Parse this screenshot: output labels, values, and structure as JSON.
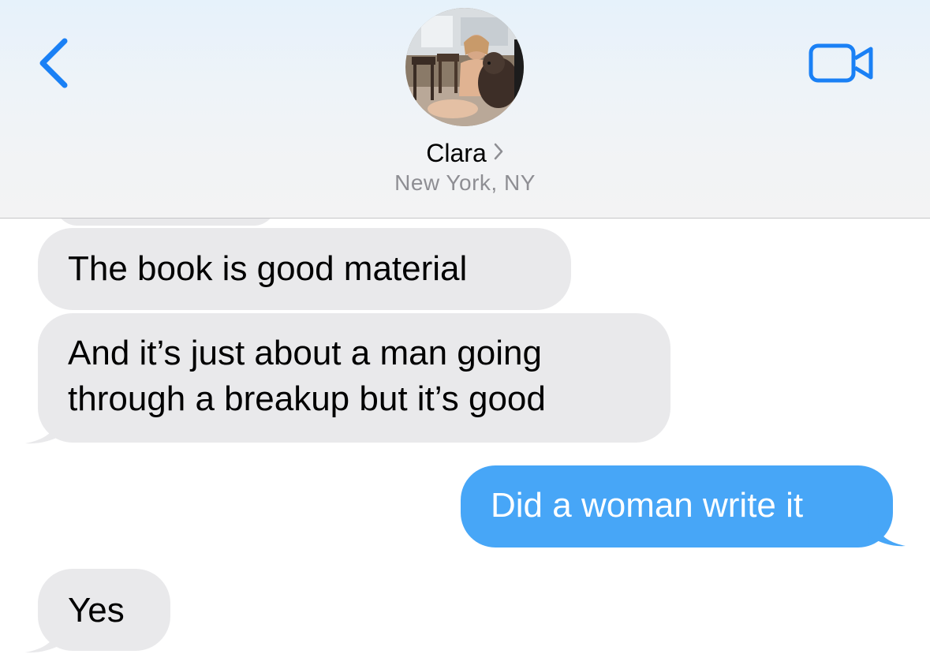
{
  "header": {
    "contact_name": "Clara",
    "contact_subtitle": "New York, NY",
    "back_icon": "chevron-left-icon",
    "video_icon": "video-camera-icon",
    "accent_color": "#1a80f5"
  },
  "messages": [
    {
      "direction": "incoming",
      "text": "The book is good material"
    },
    {
      "direction": "incoming",
      "line1": "And it’s just about a man going",
      "line2": "through a breakup but it’s good"
    },
    {
      "direction": "outgoing",
      "text": "Did a woman write it"
    },
    {
      "direction": "incoming",
      "text": "Yes"
    }
  ],
  "colors": {
    "incoming_bubble": "#e9e9eb",
    "outgoing_bubble": "#47a6f7",
    "subtitle_gray": "#8e8e93"
  }
}
